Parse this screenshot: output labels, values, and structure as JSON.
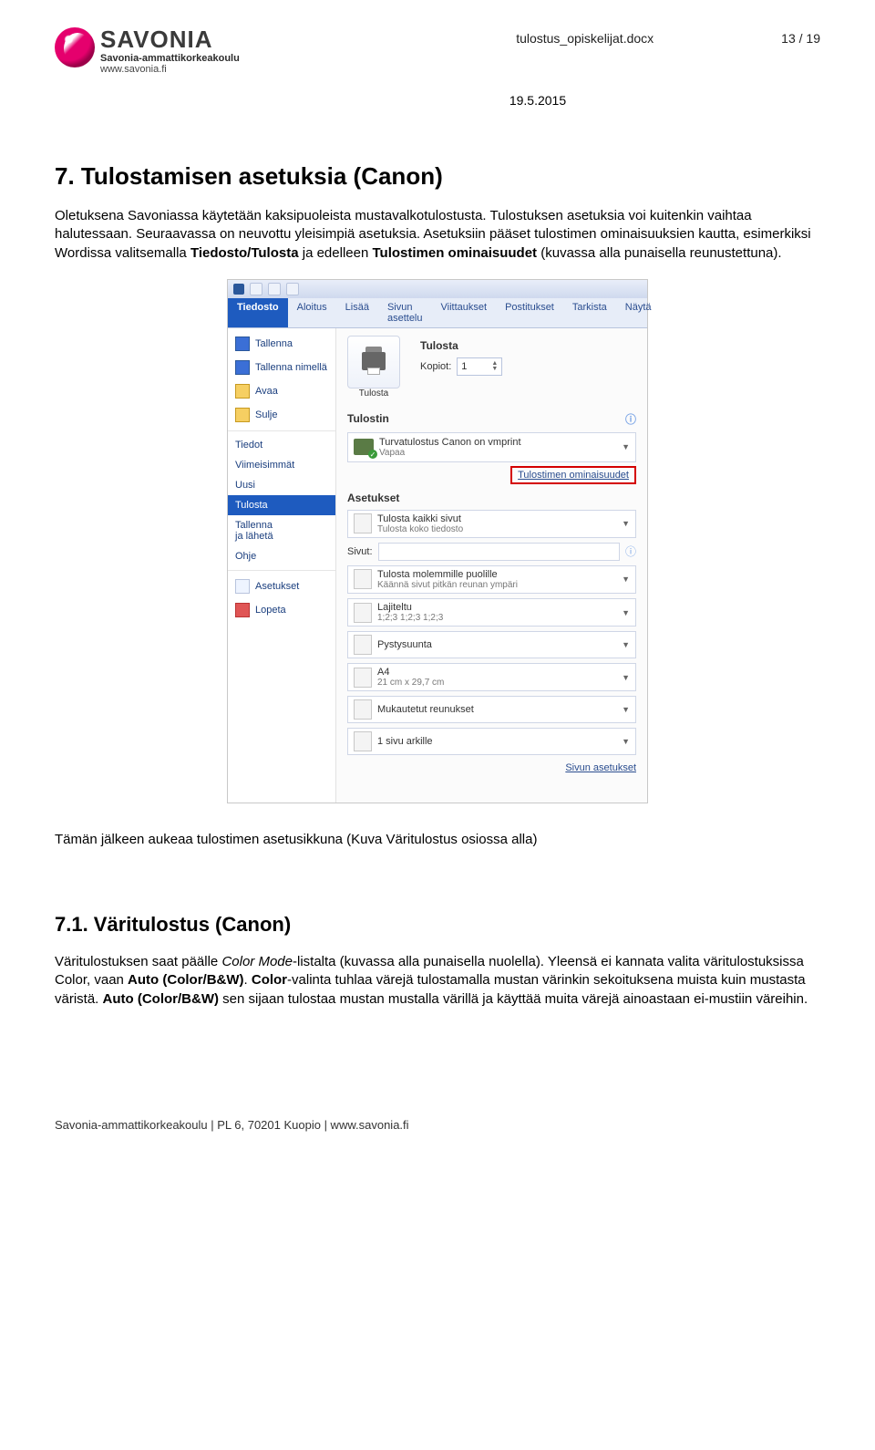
{
  "header": {
    "logo_main": "SAVONIA",
    "logo_sub": "Savonia-ammattikorkeakoulu",
    "logo_url": "www.savonia.fi",
    "doc_name": "tulostus_opiskelijat.docx",
    "page_of": "13 / 19",
    "date": "19.5.2015"
  },
  "body": {
    "h7": "7. Tulostamisen asetuksia (Canon)",
    "p7a": "Oletuksena Savoniassa käytetään kaksipuoleista mustavalkotulostusta. Tulostuksen asetuksia voi kuitenkin vaihtaa halutessaan. Seuraavassa on neuvottu yleisimpiä asetuksia. Asetuksiin pääset tulostimen ominaisuuksien kautta, esimerkiksi Wordissa valitsemalla ",
    "p7b_bold": "Tiedosto/Tulosta",
    "p7c": " ja edelleen ",
    "p7d_bold": "Tulostimen ominaisuudet",
    "p7e": " (kuvassa alla punaisella reunustettuna).",
    "after_ss": "Tämän jälkeen aukeaa tulostimen asetusikkuna (Kuva Väritulostus osiossa alla)",
    "h71": "7.1. Väritulostus (Canon)",
    "p71a": "Väritulostuksen saat päälle ",
    "p71a_em": "Color Mode",
    "p71b": "-listalta (kuvassa alla punaisella nuolella). Yleensä ei kannata valita väritulostuksissa Color, vaan ",
    "p71c_bold": "Auto (Color/B&W)",
    "p71d": ". ",
    "p71e_bold": "Color",
    "p71f": "-valinta tuhlaa värejä tulostamalla mustan värinkin sekoituksena muista kuin mustasta väristä. ",
    "p71g_bold": "Auto (Color/B&W)",
    "p71h": " sen sijaan tulostaa mustan mustalla värillä ja käyttää muita värejä ainoastaan ei-mustiin väreihin."
  },
  "word": {
    "tabs": [
      "Tiedosto",
      "Aloitus",
      "Lisää",
      "Sivun asettelu",
      "Viittaukset",
      "Postitukset",
      "Tarkista",
      "Näytä"
    ],
    "filemenu": {
      "tallenna": "Tallenna",
      "tallenna_nimella": "Tallenna nimellä",
      "avaa": "Avaa",
      "sulje": "Sulje",
      "tiedot": "Tiedot",
      "viimeisimmat": "Viimeisimmät",
      "uusi": "Uusi",
      "tulosta": "Tulosta",
      "tallenna_laheta": "Tallenna\nja lähetä",
      "ohje": "Ohje",
      "asetukset": "Asetukset",
      "lopeta": "Lopeta"
    },
    "print": {
      "section1": "Tulosta",
      "big_label": "Tulosta",
      "kopiot_label": "Kopiot:",
      "kopiot_val": "1",
      "section2": "Tulostin",
      "printer_name": "Turvatulostus Canon on vmprint",
      "printer_status": "Vapaa",
      "printer_props": "Tulostimen ominaisuudet",
      "section3": "Asetukset",
      "opt1_t": "Tulosta kaikki sivut",
      "opt1_s": "Tulosta koko tiedosto",
      "sivut": "Sivut:",
      "opt2_t": "Tulosta molemmille puolille",
      "opt2_s": "Käännä sivut pitkän reunan ympäri",
      "opt3_t": "Lajiteltu",
      "opt3_s": "1;2;3   1;2;3   1;2;3",
      "opt4_t": "Pystysuunta",
      "opt5_t": "A4",
      "opt5_s": "21 cm x 29,7 cm",
      "opt6_t": "Mukautetut reunukset",
      "opt7_t": "1 sivu arkille",
      "page_setup": "Sivun asetukset"
    }
  },
  "footer": "Savonia-ammattikorkeakoulu | PL 6, 70201 Kuopio | www.savonia.fi"
}
